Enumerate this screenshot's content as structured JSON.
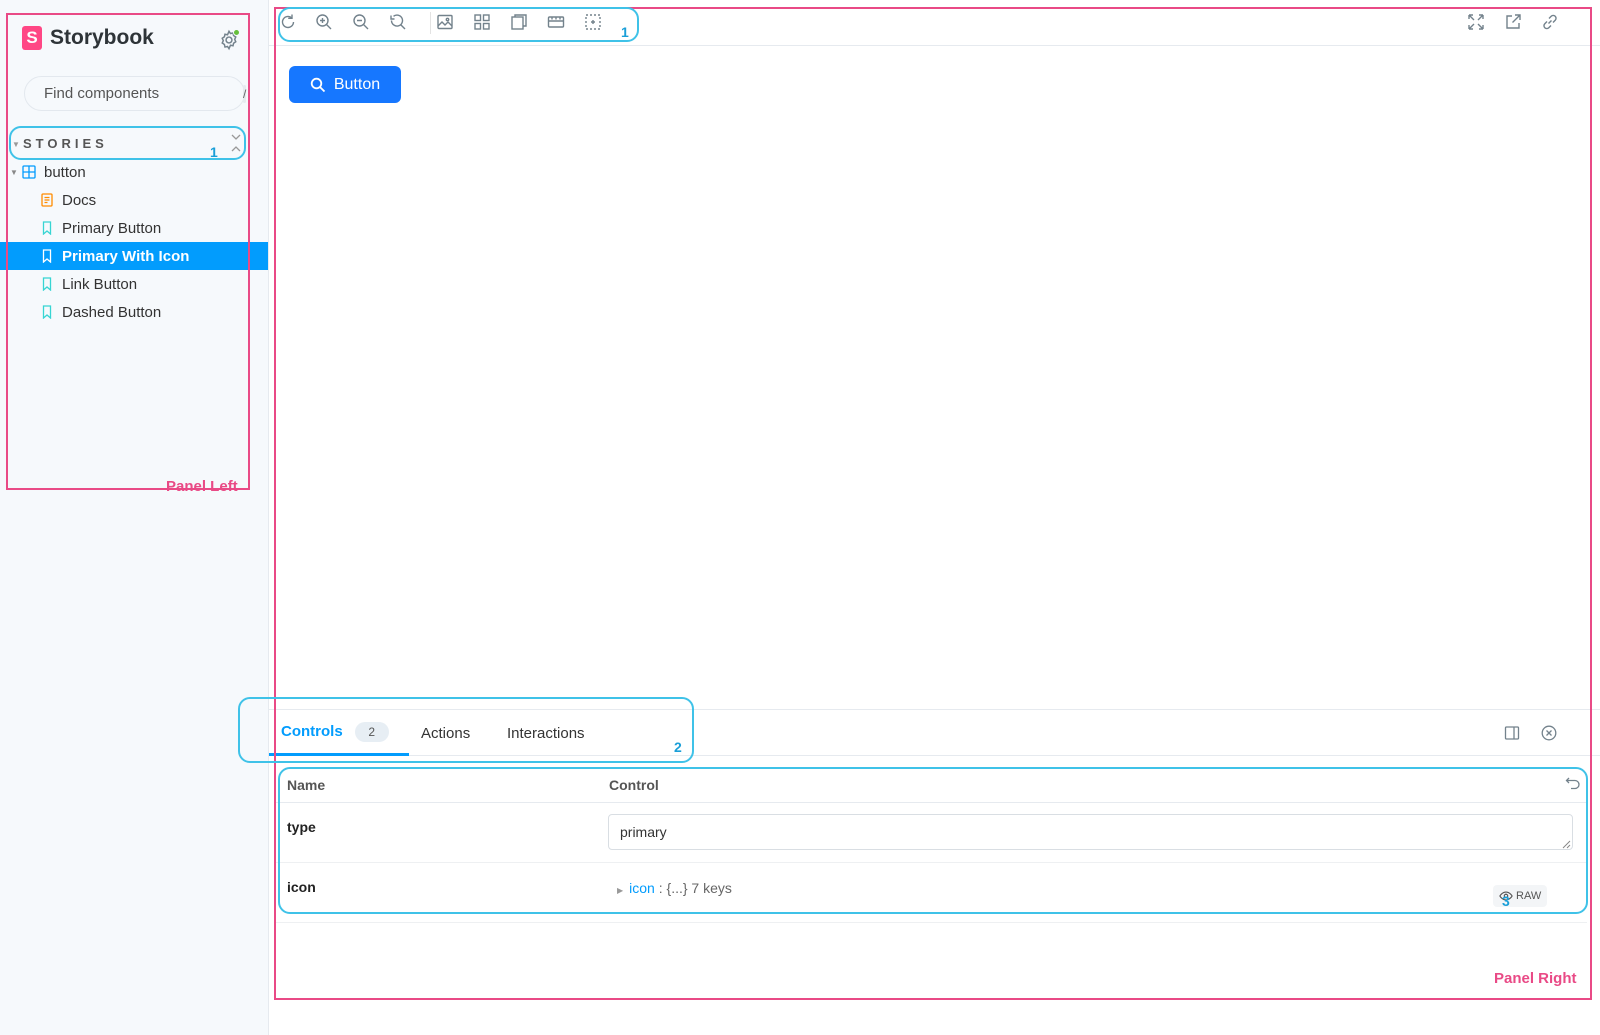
{
  "sidebar": {
    "brand": {
      "logo_letter": "S",
      "name": "Storybook"
    },
    "settings_icon": "gear-icon",
    "search": {
      "placeholder": "Find components",
      "shortcut": "/"
    },
    "stories_label": "STORIES",
    "tree": {
      "group": {
        "label": "button",
        "icon": "component-icon"
      },
      "items": [
        {
          "label": "Docs",
          "icon": "document-icon",
          "selected": false
        },
        {
          "label": "Primary Button",
          "icon": "bookmark-icon",
          "selected": false
        },
        {
          "label": "Primary With Icon",
          "icon": "bookmark-icon",
          "selected": true
        },
        {
          "label": "Link Button",
          "icon": "bookmark-icon",
          "selected": false
        },
        {
          "label": "Dashed Button",
          "icon": "bookmark-icon",
          "selected": false
        }
      ]
    }
  },
  "toolbar": {
    "left_tools": [
      "reload-icon",
      "zoom-in-icon",
      "zoom-out-icon",
      "reset-zoom-icon",
      "background-icon",
      "grid-icon",
      "viewport-icon",
      "measure-icon",
      "outline-icon"
    ],
    "right_tools": [
      "fullscreen-icon",
      "open-new-tab-icon",
      "copy-link-icon"
    ]
  },
  "preview": {
    "button_label": "Button",
    "button_color": "#1677ff"
  },
  "panel": {
    "tabs": [
      {
        "label": "Controls",
        "badge": "2",
        "active": true
      },
      {
        "label": "Actions",
        "active": false
      },
      {
        "label": "Interactions",
        "active": false
      }
    ],
    "controls": {
      "headers": {
        "name": "Name",
        "control": "Control"
      },
      "rows": {
        "type": {
          "name": "type",
          "value": "primary"
        },
        "icon": {
          "name": "icon",
          "key": "icon",
          "summary": ": {...} 7 keys",
          "raw_label": "RAW"
        }
      }
    }
  },
  "annotations": {
    "panel_left": "Panel Left",
    "panel_right": "Panel Right",
    "label_1": "1",
    "label_2": "2",
    "label_3": "3"
  },
  "colors": {
    "accent": "#029cfd",
    "brand": "#ff4785",
    "annotation_pink": "#e94a86",
    "annotation_blue": "#3fc2e8"
  }
}
